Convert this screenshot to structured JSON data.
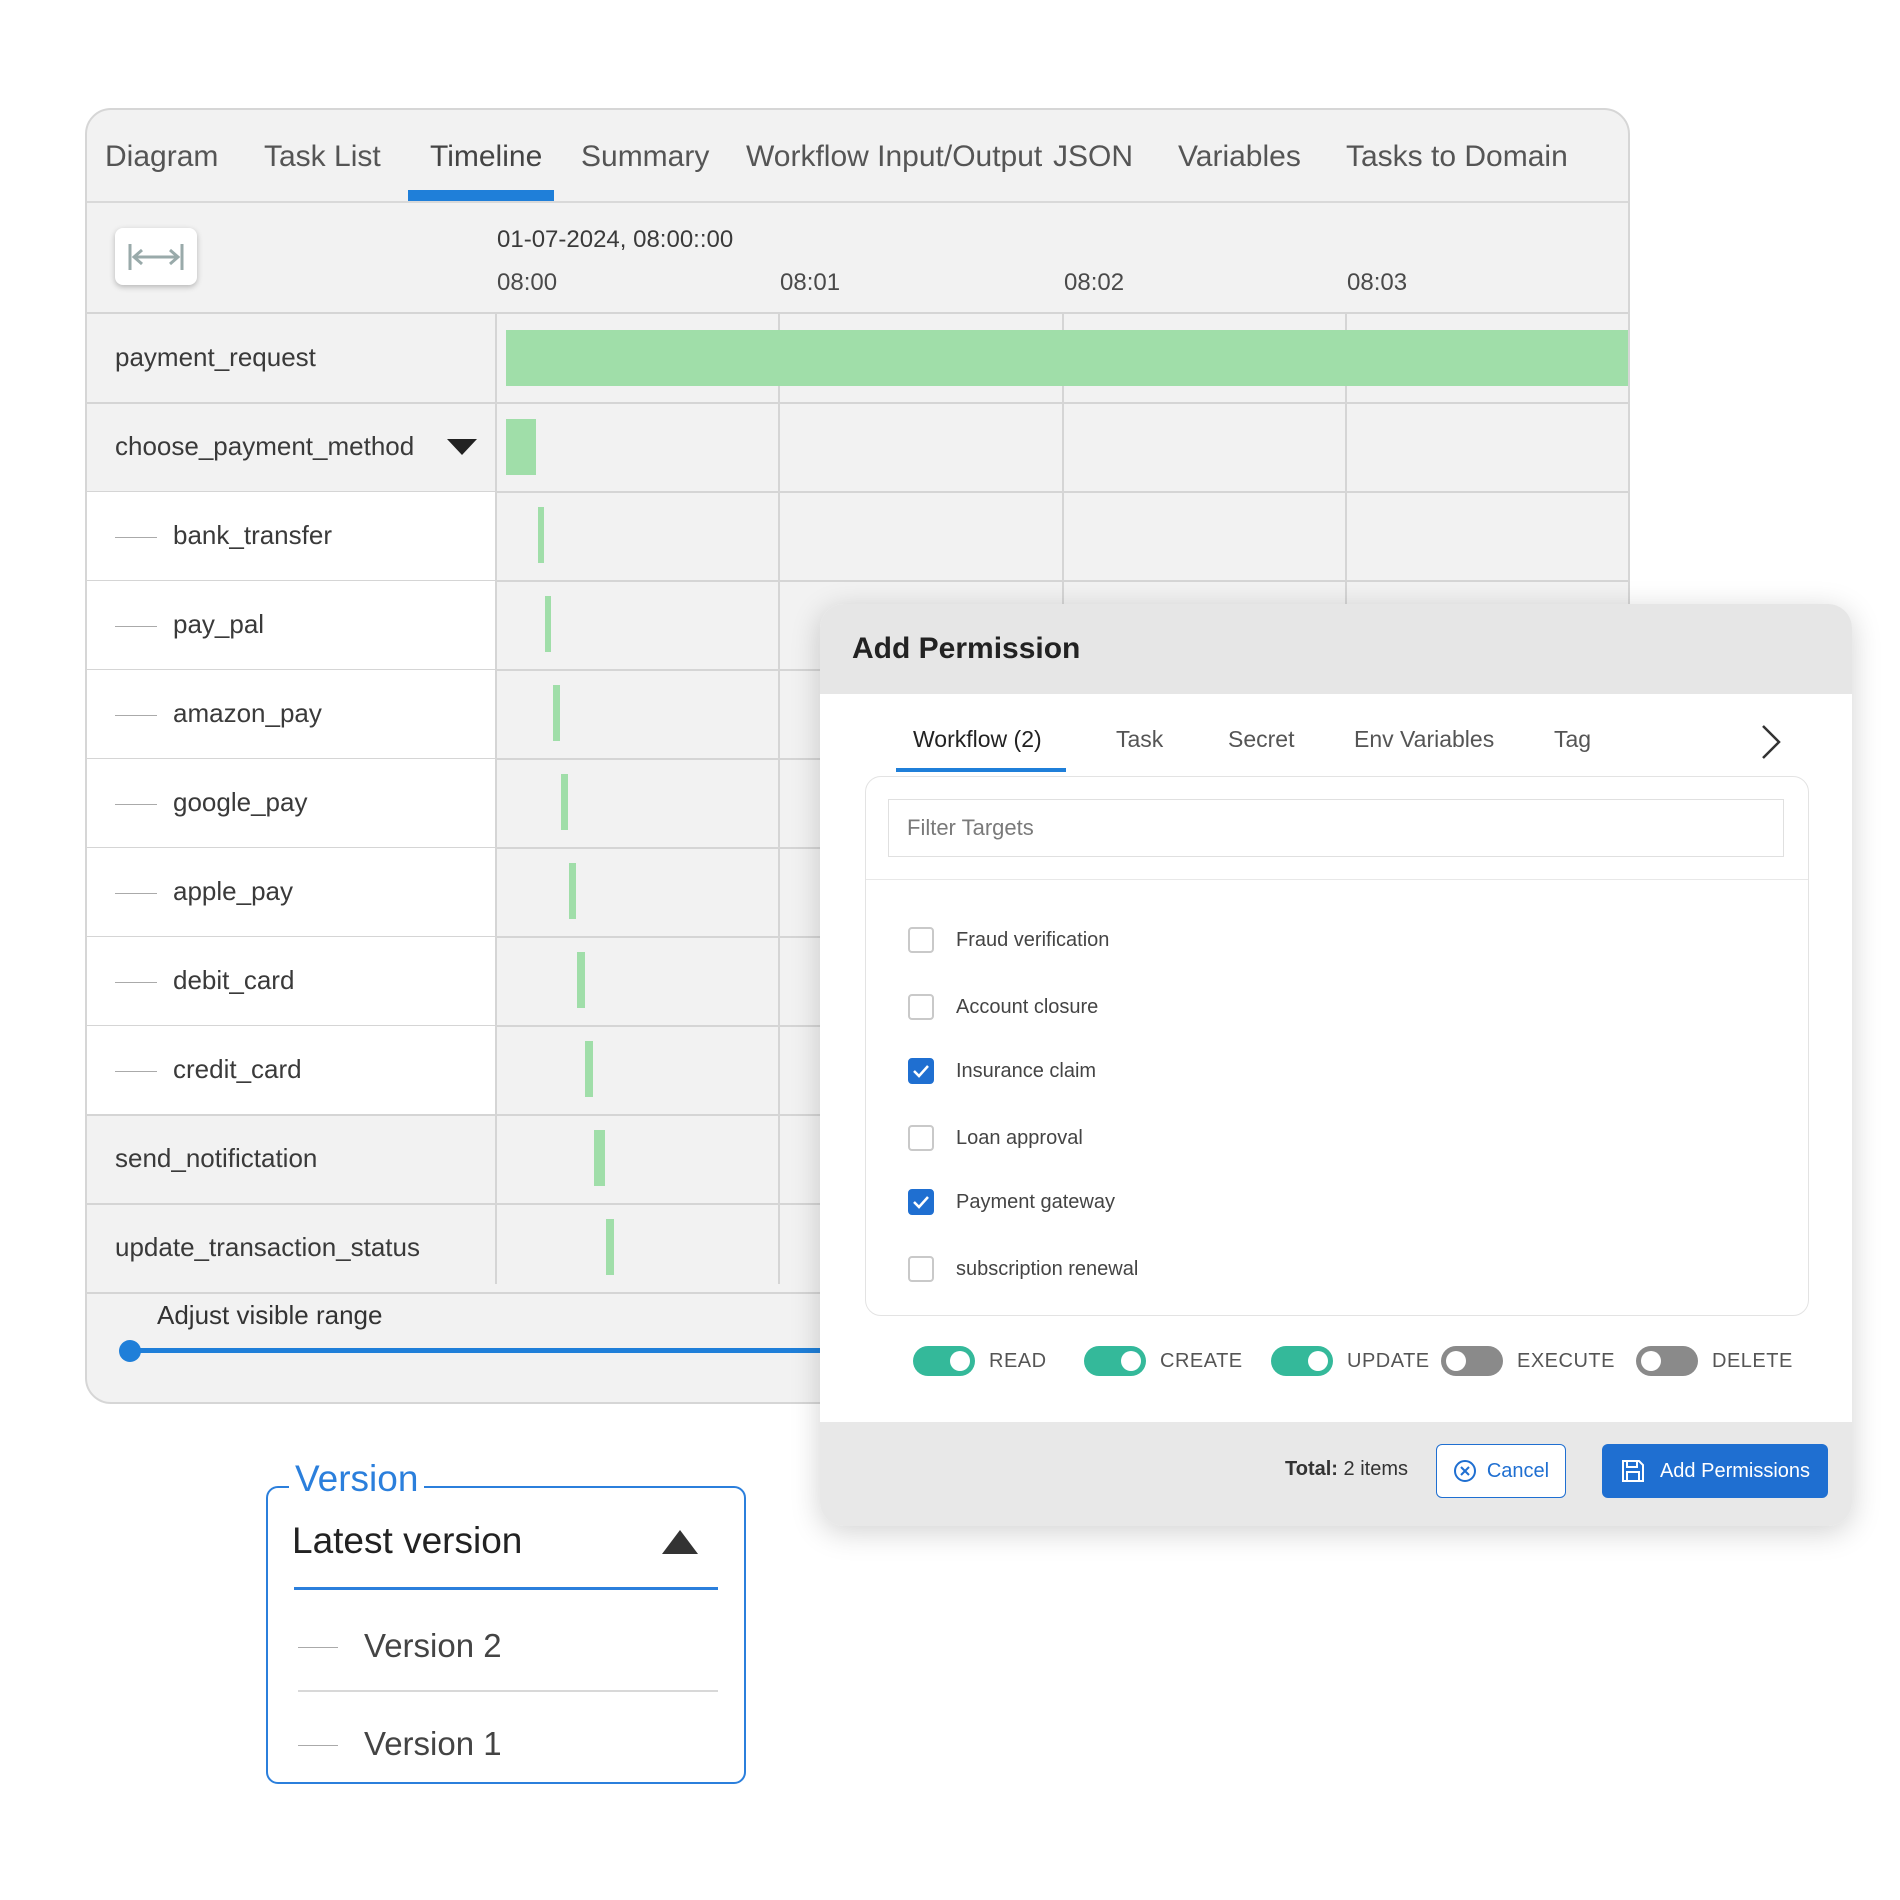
{
  "timeline_panel": {
    "tabs": [
      {
        "label": "Diagram"
      },
      {
        "label": "Task List"
      },
      {
        "label": "Timeline"
      },
      {
        "label": "Summary"
      },
      {
        "label": "Workflow Input/Output"
      },
      {
        "label": "JSON"
      },
      {
        "label": "Variables"
      },
      {
        "label": "Tasks to Domain"
      }
    ],
    "active_tab": "Timeline",
    "date_header": "01-07-2024, 08:00::00",
    "time_ticks": [
      "08:00",
      "08:01",
      "08:02",
      "08:03"
    ],
    "tasks": [
      {
        "label": "payment_request"
      },
      {
        "label": "choose_payment_method"
      },
      {
        "label": "bank_transfer"
      },
      {
        "label": "pay_pal"
      },
      {
        "label": "amazon_pay"
      },
      {
        "label": "google_pay"
      },
      {
        "label": "apple_pay"
      },
      {
        "label": "debit_card"
      },
      {
        "label": "credit_card"
      },
      {
        "label": "send_notifictation"
      },
      {
        "label": "update_transaction_status"
      }
    ],
    "range_label": "Adjust visible range",
    "bar_color": "#a0dea9",
    "accent_color": "#1f7fd9"
  },
  "permission_modal": {
    "title": "Add Permission",
    "tabs": [
      {
        "label": "Workflow (2)"
      },
      {
        "label": "Task"
      },
      {
        "label": "Secret"
      },
      {
        "label": "Env Variables"
      },
      {
        "label": "Tag"
      }
    ],
    "active_tab": "Workflow (2)",
    "filter_placeholder": "Filter Targets",
    "targets": [
      {
        "label": "Fraud verification",
        "checked": false
      },
      {
        "label": "Account closure",
        "checked": false
      },
      {
        "label": "Insurance claim",
        "checked": true
      },
      {
        "label": "Loan approval",
        "checked": false
      },
      {
        "label": "Payment gateway",
        "checked": true
      },
      {
        "label": "subscription renewal",
        "checked": false
      }
    ],
    "permissions": [
      {
        "label": "READ",
        "on": true
      },
      {
        "label": "CREATE",
        "on": true
      },
      {
        "label": "UPDATE",
        "on": true
      },
      {
        "label": "EXECUTE",
        "on": false
      },
      {
        "label": "DELETE",
        "on": false
      }
    ],
    "total_label": "Total:",
    "total_value": "2 items",
    "cancel_label": "Cancel",
    "add_label": "Add Permissions",
    "toggle_on_color": "#34b99a",
    "primary_color": "#1f6fd1"
  },
  "version_select": {
    "legend": "Version",
    "selected": "Latest version",
    "options": [
      {
        "label": "Version 2"
      },
      {
        "label": "Version 1"
      }
    ]
  }
}
